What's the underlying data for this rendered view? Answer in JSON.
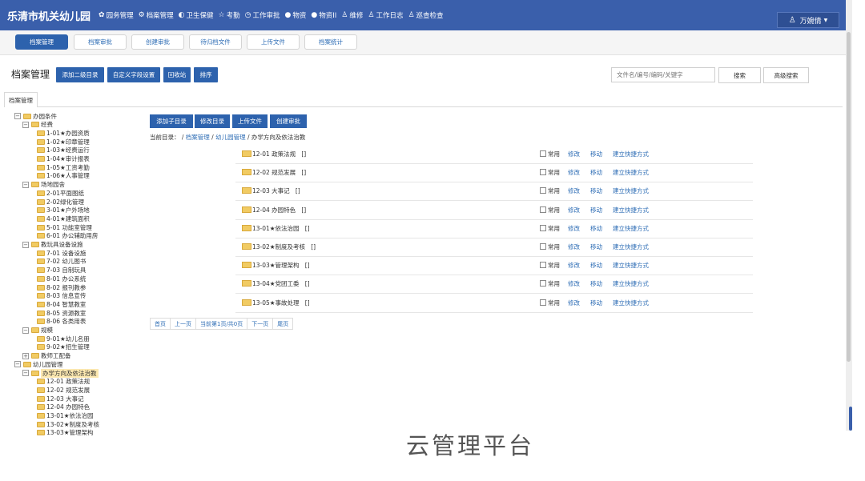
{
  "app": {
    "title": "乐清市机关幼儿园"
  },
  "nav": [
    {
      "icon": "gear-icon",
      "glyph": "✿",
      "label": "园务管理"
    },
    {
      "icon": "archive-icon",
      "glyph": "⚙",
      "label": "档案管理"
    },
    {
      "icon": "health-icon",
      "glyph": "◐",
      "label": "卫生保健"
    },
    {
      "icon": "star-icon",
      "glyph": "☆",
      "label": "考勤"
    },
    {
      "icon": "clock-icon",
      "glyph": "◷",
      "label": "工作审批"
    },
    {
      "icon": "drop-icon",
      "glyph": "●",
      "label": "物资"
    },
    {
      "icon": "drop-icon",
      "glyph": "●",
      "label": "物资II"
    },
    {
      "icon": "person-icon",
      "glyph": "♙",
      "label": "维修"
    },
    {
      "icon": "person-icon",
      "glyph": "♙",
      "label": "工作日志"
    },
    {
      "icon": "person-icon",
      "glyph": "♙",
      "label": "巡查检查"
    }
  ],
  "user": {
    "name": "万婉倩"
  },
  "subtabs": [
    "档案管理",
    "档案审批",
    "创建审批",
    "待归档文件",
    "上传文件",
    "档案统计"
  ],
  "toolbar": {
    "title": "档案管理",
    "buttons": [
      "添加二级目录",
      "自定义字段设置",
      "回收站",
      "排序"
    ],
    "search_placeholder": "文件名/编号/编码/关键字",
    "search_label": "搜索",
    "advanced_label": "高级搜索"
  },
  "tab": {
    "label": "档案管理"
  },
  "tree": [
    {
      "level": 0,
      "toggle": "⊟",
      "label": "办园条件"
    },
    {
      "level": 1,
      "toggle": "⊟",
      "label": "经费"
    },
    {
      "level": 2,
      "label": "1-01★办园资质"
    },
    {
      "level": 2,
      "label": "1-02★印章管理"
    },
    {
      "level": 2,
      "label": "1-03★经费运行"
    },
    {
      "level": 2,
      "label": "1-04★审计报表"
    },
    {
      "level": 2,
      "label": "1-05★工资考勤"
    },
    {
      "level": 2,
      "label": "1-06★人事管理"
    },
    {
      "level": 1,
      "toggle": "⊟",
      "label": "场地园舍"
    },
    {
      "level": 2,
      "label": "2-01平面图纸"
    },
    {
      "level": 2,
      "label": "2-02绿化管理"
    },
    {
      "level": 2,
      "label": "3-01★户外场地"
    },
    {
      "level": 2,
      "label": "4-01★建筑面积"
    },
    {
      "level": 2,
      "label": "5-01 功能室管理"
    },
    {
      "level": 2,
      "label": "6-01 办公辅助用房"
    },
    {
      "level": 1,
      "toggle": "⊟",
      "label": "教玩具设备设施"
    },
    {
      "level": 2,
      "label": "7-01 设备设施"
    },
    {
      "level": 2,
      "label": "7-02 幼儿图书"
    },
    {
      "level": 2,
      "label": "7-03 自制玩具"
    },
    {
      "level": 2,
      "label": "8-01 办公系统"
    },
    {
      "level": 2,
      "label": "8-02 报刊教参"
    },
    {
      "level": 2,
      "label": "8-03 信息宣传"
    },
    {
      "level": 2,
      "label": "8-04 智慧教室"
    },
    {
      "level": 2,
      "label": "8-05 资源教室"
    },
    {
      "level": 2,
      "label": "8-06 各类用表"
    },
    {
      "level": 1,
      "toggle": "⊟",
      "label": "规模"
    },
    {
      "level": 2,
      "label": "9-01★幼儿名册"
    },
    {
      "level": 2,
      "label": "9-02★招生管理"
    },
    {
      "level": 1,
      "toggle": "⊞",
      "label": "教师工配备"
    },
    {
      "level": 0,
      "toggle": "⊟",
      "label": "幼儿园管理"
    },
    {
      "level": 1,
      "toggle": "⊟",
      "label": "办学方向及依法治教",
      "selected": true
    },
    {
      "level": 2,
      "label": "12-01 政策法规"
    },
    {
      "level": 2,
      "label": "12-02 规范发展"
    },
    {
      "level": 2,
      "label": "12-03 大事记"
    },
    {
      "level": 2,
      "label": "12-04 办园特色"
    },
    {
      "level": 2,
      "label": "13-01★依法治园"
    },
    {
      "level": 2,
      "label": "13-02★制度及考核"
    },
    {
      "level": 2,
      "label": "13-03★管理架构"
    }
  ],
  "content": {
    "buttons": [
      "添加子目录",
      "修改目录",
      "上传文件",
      "创建审批"
    ],
    "breadcrumb": {
      "prefix": "当前目录：",
      "sep": " / ",
      "links": [
        "档案管理",
        "幼儿园管理"
      ],
      "current": "办学方向及依法治教"
    },
    "row_labels": {
      "common": "常用",
      "edit": "修改",
      "move": "移动",
      "shortcut": "建立快捷方式"
    },
    "rows": [
      {
        "name": "12-01 政策法规",
        "count": "[]"
      },
      {
        "name": "12-02 规范发展",
        "count": "[]"
      },
      {
        "name": "12-03 大事记",
        "count": "[]"
      },
      {
        "name": "12-04 办园特色",
        "count": "[]"
      },
      {
        "name": "13-01★依法治园",
        "count": "[]"
      },
      {
        "name": "13-02★制度及考核",
        "count": "[]"
      },
      {
        "name": "13-03★管理架构",
        "count": "[]"
      },
      {
        "name": "13-04★党团工委",
        "count": "[]"
      },
      {
        "name": "13-05★事故处理",
        "count": "[]"
      }
    ],
    "pager": [
      "首页",
      "上一页",
      "当前第1页/共0页",
      "下一页",
      "尾页"
    ]
  },
  "watermark": "云管理平台",
  "colors": {
    "header": "#3a5fab",
    "primary": "#2d62ad",
    "link": "#2e6db5",
    "folder": "#f1cb63"
  }
}
